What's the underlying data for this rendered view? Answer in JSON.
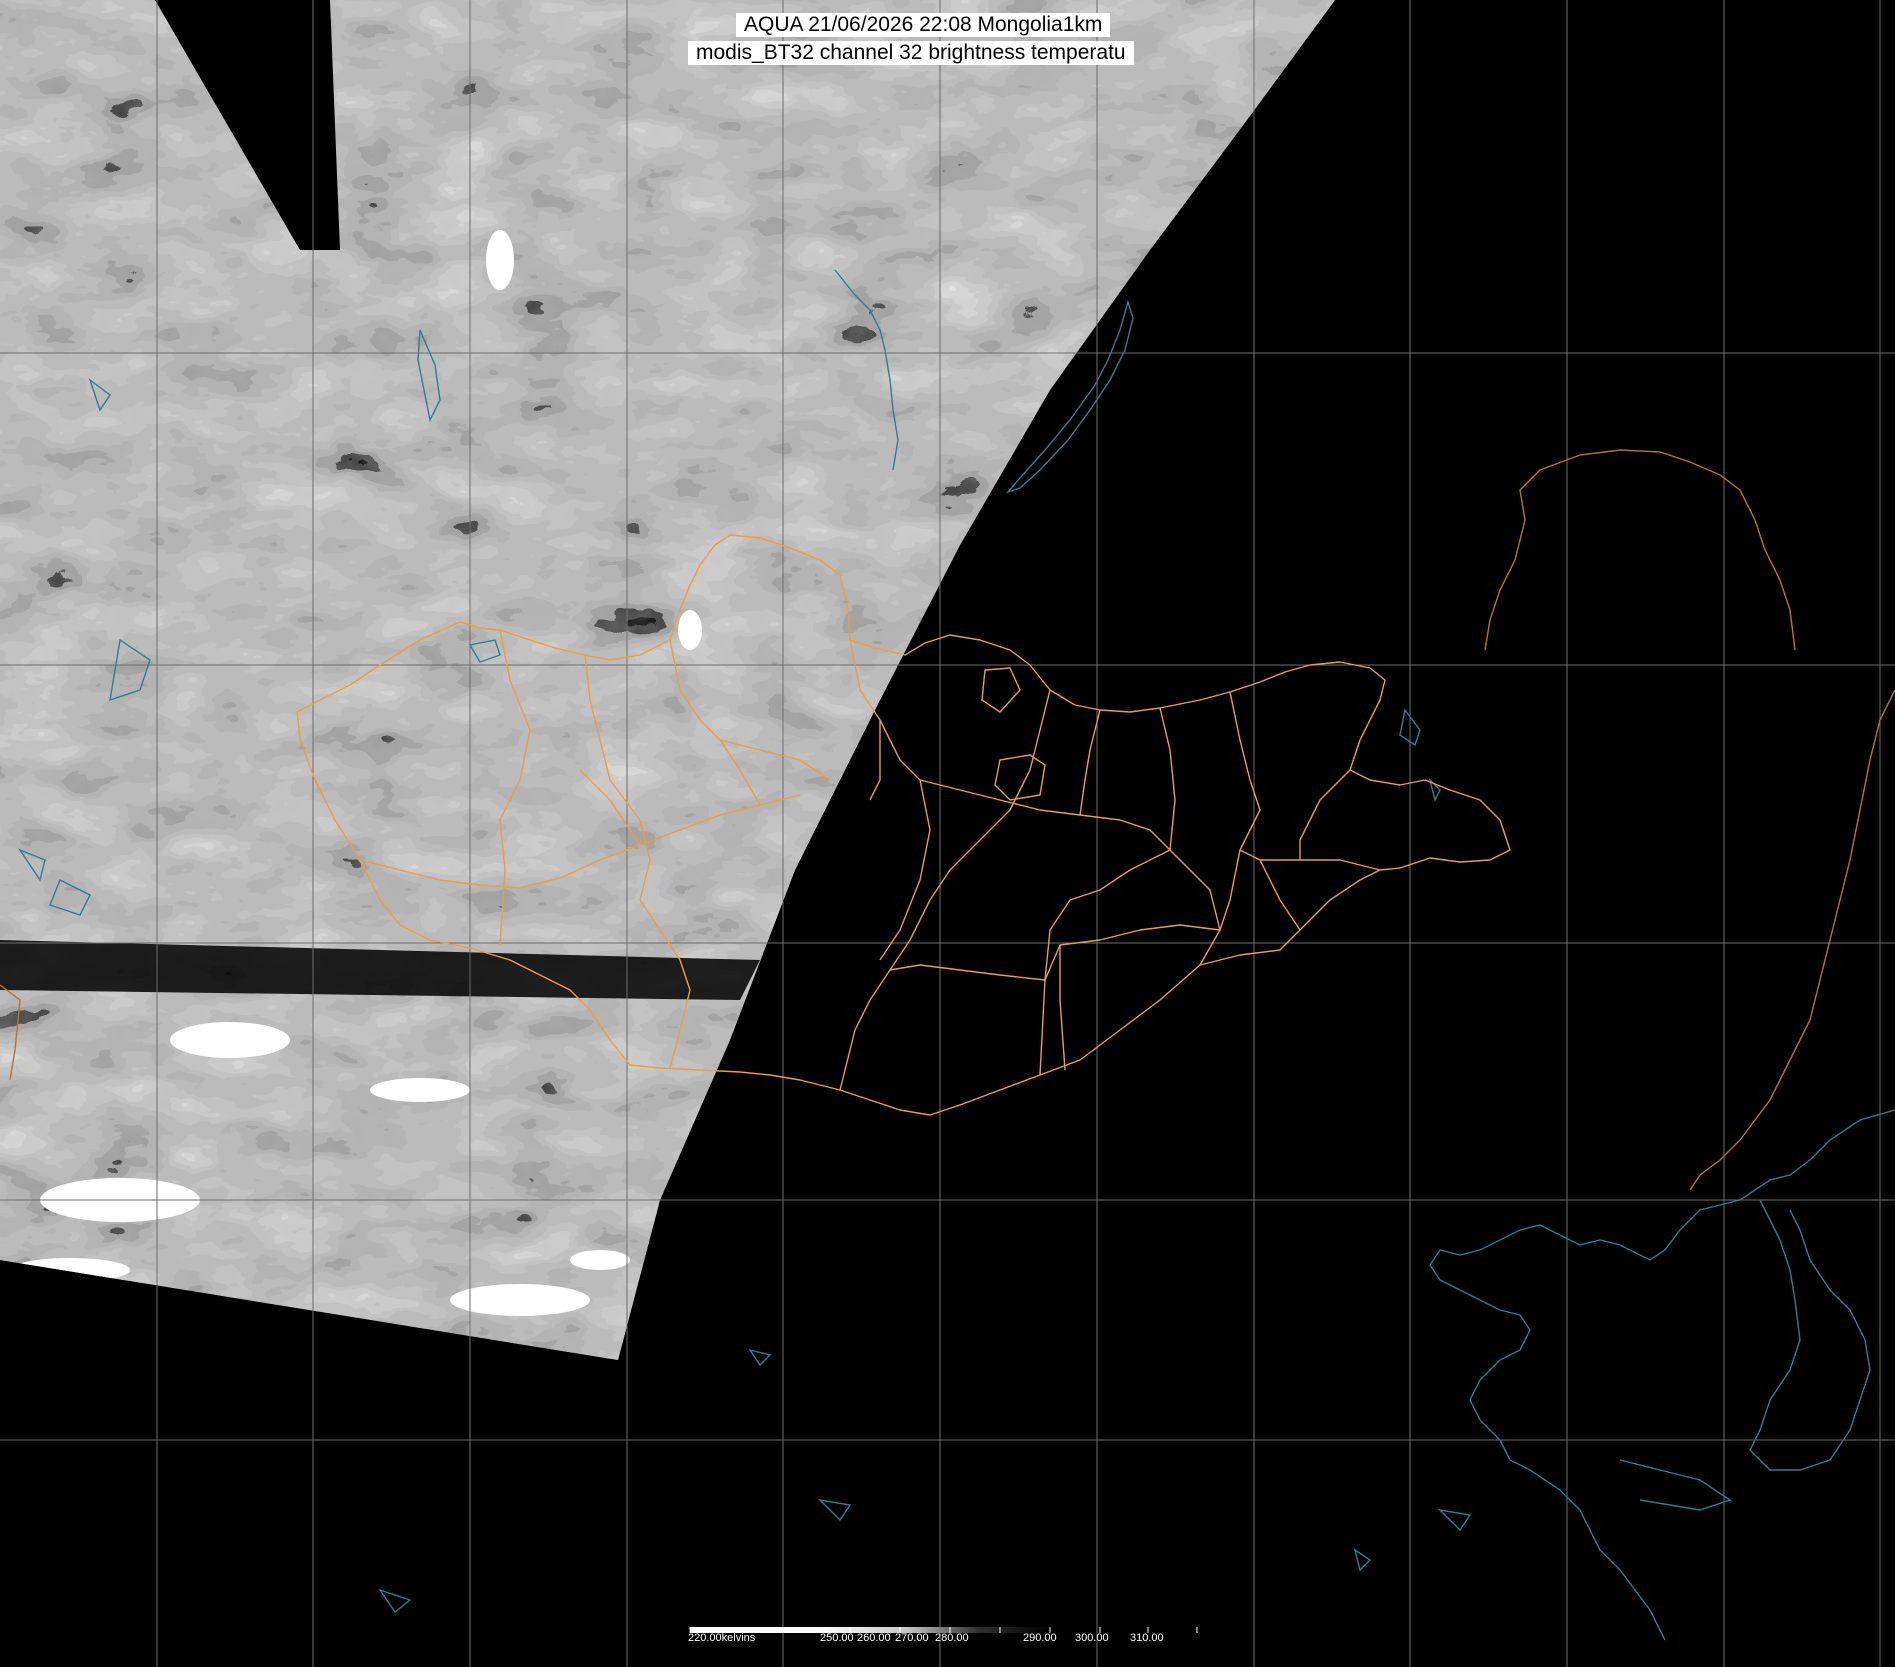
{
  "header": {
    "title_line1": "AQUA 21/06/2026 22:08 Mongolia1km",
    "title_line2": "modis_BT32 channel 32 brightness temperatu"
  },
  "colorbar": {
    "unit_label": "220.00kelvins",
    "tick_labels": [
      "250.00",
      "260.00",
      "270.00",
      "280.00",
      "290.00",
      "300.00",
      "310.00"
    ],
    "min_value": 220,
    "max_value": 320,
    "gradient": "white-to-black"
  },
  "colors": {
    "background": "#000000",
    "grid": "#6e6e6e",
    "province_borders": "#e8a040",
    "country_borders": "#b8742e",
    "water_coastlines": "#2f7f8f"
  },
  "layers": [
    "satellite-swath",
    "lat-lon-grid",
    "coastlines-and-lakes",
    "province-borders",
    "country-borders",
    "title",
    "colorbar"
  ]
}
